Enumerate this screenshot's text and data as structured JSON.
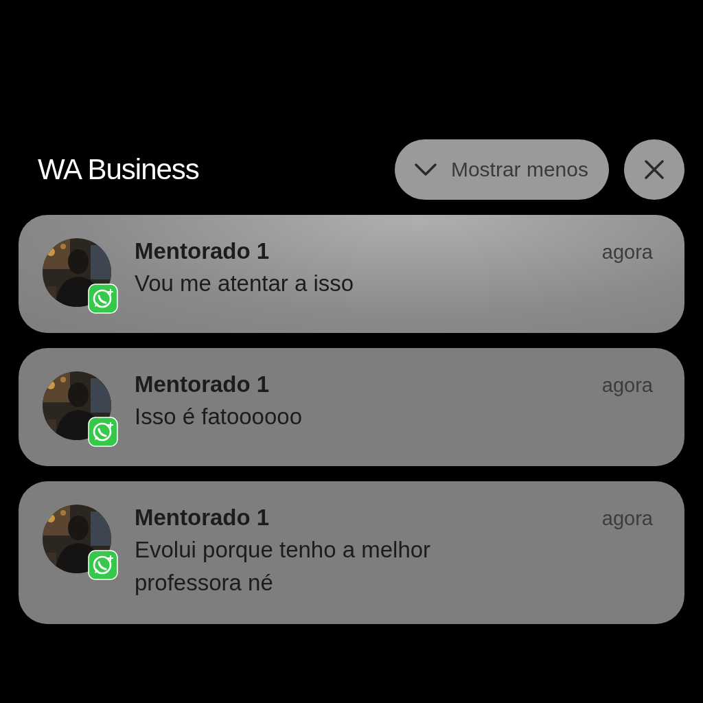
{
  "header": {
    "app_name": "WA Business",
    "collapse_button": "Mostrar menos"
  },
  "notifications": [
    {
      "sender": "Mentorado 1",
      "time": "agora",
      "message": "Vou me atentar a isso"
    },
    {
      "sender": "Mentorado 1",
      "time": "agora",
      "message": "Isso é fatoooooo"
    },
    {
      "sender": "Mentorado 1",
      "time": "agora",
      "message": "Evolui porque tenho a melhor professora né"
    }
  ]
}
